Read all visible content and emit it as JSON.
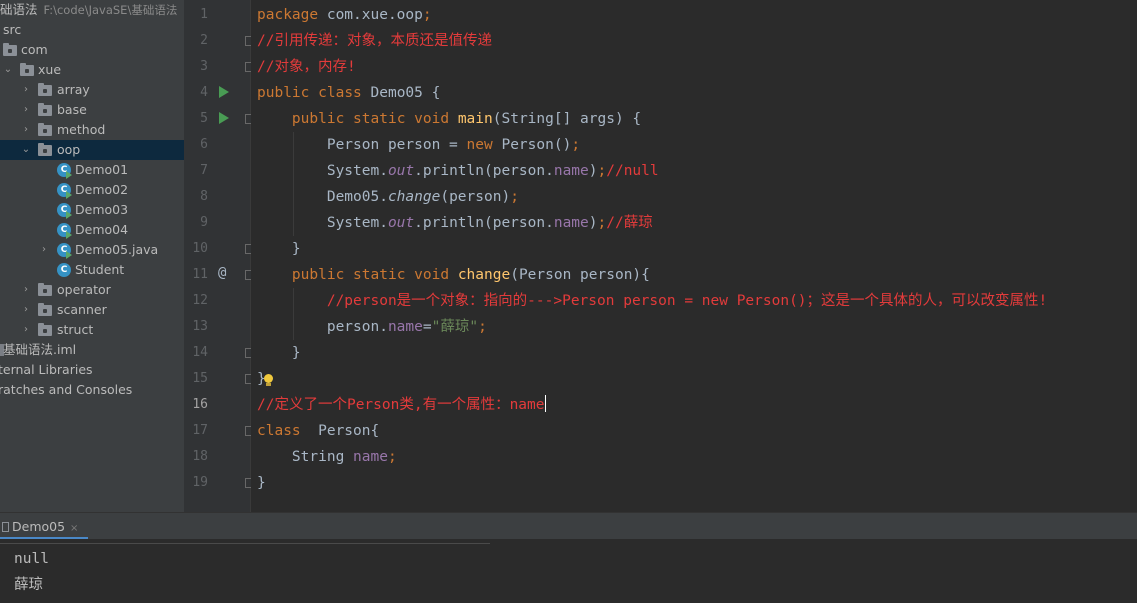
{
  "project": {
    "root_name": "础语法",
    "root_path": "F:\\code\\JavaSE\\基础语法",
    "tree": [
      {
        "label": "src"
      },
      {
        "label": "com"
      },
      {
        "label": "xue"
      },
      {
        "label": "array"
      },
      {
        "label": "base"
      },
      {
        "label": "method"
      },
      {
        "label": "oop",
        "selected": true
      },
      {
        "label": "Demo01"
      },
      {
        "label": "Demo02"
      },
      {
        "label": "Demo03"
      },
      {
        "label": "Demo04"
      },
      {
        "label": "Demo05.java"
      },
      {
        "label": "Student"
      },
      {
        "label": "operator"
      },
      {
        "label": "scanner"
      },
      {
        "label": "struct"
      },
      {
        "label": "基础语法.iml"
      },
      {
        "label": "ternal Libraries"
      },
      {
        "label": "ratches and Consoles"
      }
    ]
  },
  "editor": {
    "line_numbers": [
      "1",
      "2",
      "3",
      "4",
      "5",
      "6",
      "7",
      "8",
      "9",
      "10",
      "11",
      "12",
      "13",
      "14",
      "15",
      "16",
      "17",
      "18",
      "19"
    ],
    "current_line": "16",
    "gutter_at_symbol": "@",
    "code": {
      "l1_pkg_kw": "package",
      "l1_pkg_name": " com.xue.oop",
      "l1_semi": ";",
      "l2_comment": "//引用传递：对象，本质还是值传递",
      "l3_comment": "//对象，内存!",
      "l4_public": "public",
      "l4_class": "class",
      "l4_name": " Demo05 {",
      "l5_public": "public",
      "l5_static": "static",
      "l5_void": "void",
      "l5_main": "main",
      "l5_params": "(String[] args) {",
      "l6_decl": "Person person = ",
      "l6_new": "new",
      "l6_ctor": " Person()",
      "l6_semi": ";",
      "l7_sys": "System.",
      "l7_out": "out",
      "l7_call": ".println(person.",
      "l7_name": "name",
      "l7_close": ")",
      "l7_semi": ";",
      "l7_comment": "//null",
      "l8_cls": "Demo05.",
      "l8_change": "change",
      "l8_args": "(person)",
      "l8_semi": ";",
      "l9_sys": "System.",
      "l9_out": "out",
      "l9_call": ".println(person.",
      "l9_name": "name",
      "l9_close": ")",
      "l9_semi": ";",
      "l9_comment": "//薛琼",
      "l10_brace": "}",
      "l11_public": "public",
      "l11_static": "static",
      "l11_void": "void",
      "l11_change": "change",
      "l11_params": "(Person person){",
      "l12_comment": "//person是一个对象：指向的--->Person person = new Person()；这是一个具体的人，可以改变属性!",
      "l13_obj": "person.",
      "l13_name": "name",
      "l13_eq": "=",
      "l13_str": "\"薛琼\"",
      "l13_semi": ";",
      "l14_brace": "}",
      "l15_brace": "}",
      "l16_comment": "//定义了一个Person类,有一个属性：name",
      "l17_class": "class",
      "l17_name": "  Person{",
      "l18_type": "String ",
      "l18_name": "name",
      "l18_semi": ";",
      "l19_brace": "}"
    }
  },
  "run_panel": {
    "tab_label": "Demo05",
    "close_glyph": "×",
    "output": [
      "null",
      "薛琼"
    ]
  },
  "colors": {
    "keyword": "#cc7832",
    "method": "#ffc66d",
    "field": "#9876aa",
    "string": "#6a8759",
    "comment": "#e33b3b",
    "selection": "#0d293e"
  }
}
